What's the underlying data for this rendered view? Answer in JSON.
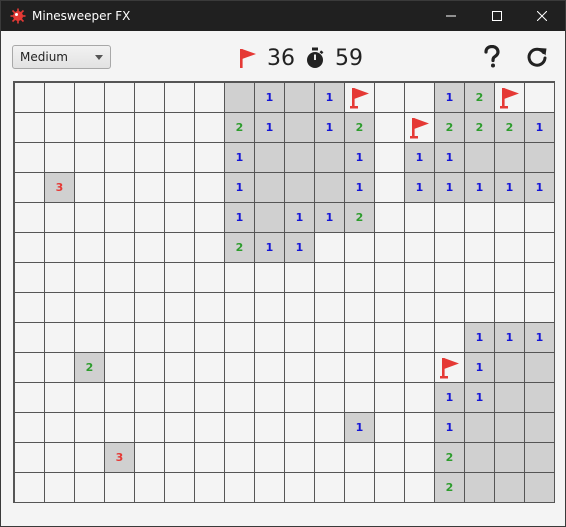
{
  "window": {
    "title": "Minesweeper FX"
  },
  "toolbar": {
    "difficulty": "Medium",
    "flags_remaining": "36",
    "timer": "59",
    "help_icon": "question-mark-icon",
    "restart_icon": "restart-icon"
  },
  "colors": {
    "flag": "#e53935",
    "num1": "#1515d6",
    "num2": "#2e9d2e",
    "num3": "#e53935",
    "revealed": "#d0d0d0",
    "hidden": "#f4f4f4",
    "titlebar": "#202020"
  },
  "board": {
    "rows": [
      [
        "",
        "",
        "",
        "",
        "",
        "",
        "",
        ".",
        "1",
        ".",
        "1",
        "F",
        "",
        "",
        "1",
        "2",
        "F",
        ""
      ],
      [
        "",
        "",
        "",
        "",
        "",
        "",
        "",
        "2",
        "1",
        ".",
        "1",
        "2",
        "",
        "F",
        "2",
        "2",
        "2",
        "1"
      ],
      [
        "",
        "",
        "",
        "",
        "",
        "",
        "",
        "1",
        ".",
        ".",
        ".",
        "1",
        "",
        "1",
        "1",
        ".",
        ".",
        "."
      ],
      [
        "",
        "3",
        "",
        "",
        "",
        "",
        "",
        "1",
        ".",
        ".",
        ".",
        "1",
        "",
        "1",
        "1",
        "1",
        "1",
        "1"
      ],
      [
        "",
        "",
        "",
        "",
        "",
        "",
        "",
        "1",
        ".",
        "1",
        "1",
        "2",
        "",
        "",
        "",
        "",
        "",
        ""
      ],
      [
        "",
        "",
        "",
        "",
        "",
        "",
        "",
        "2",
        "1",
        "1",
        "",
        "",
        "",
        "",
        "",
        "",
        "",
        ""
      ],
      [
        "",
        "",
        "",
        "",
        "",
        "",
        "",
        "",
        "",
        "",
        "",
        "",
        "",
        "",
        "",
        "",
        "",
        ""
      ],
      [
        "",
        "",
        "",
        "",
        "",
        "",
        "",
        "",
        "",
        "",
        "",
        "",
        "",
        "",
        "",
        "",
        "",
        ""
      ],
      [
        "",
        "",
        "",
        "",
        "",
        "",
        "",
        "",
        "",
        "",
        "",
        "",
        "",
        "",
        "",
        "1",
        "1",
        "1"
      ],
      [
        "",
        "",
        "2",
        "",
        "",
        "",
        "",
        "",
        "",
        "",
        "",
        "",
        "",
        "",
        "F",
        "1",
        ".",
        "."
      ],
      [
        "",
        "",
        "",
        "",
        "",
        "",
        "",
        "",
        "",
        "",
        "",
        "",
        "",
        "",
        "1",
        "1",
        ".",
        "."
      ],
      [
        "",
        "",
        "",
        "",
        "",
        "",
        "",
        "",
        "",
        "",
        "",
        "1",
        "",
        "",
        "1",
        ".",
        ".",
        "."
      ],
      [
        "",
        "",
        "",
        "3",
        "",
        "",
        "",
        "",
        "",
        "",
        "",
        "",
        "",
        "",
        "2",
        ".",
        ".",
        "."
      ],
      [
        "",
        "",
        "",
        "",
        "",
        "",
        "",
        "",
        "",
        "",
        "",
        "",
        "",
        "",
        "2",
        ".",
        ".",
        "."
      ]
    ]
  }
}
